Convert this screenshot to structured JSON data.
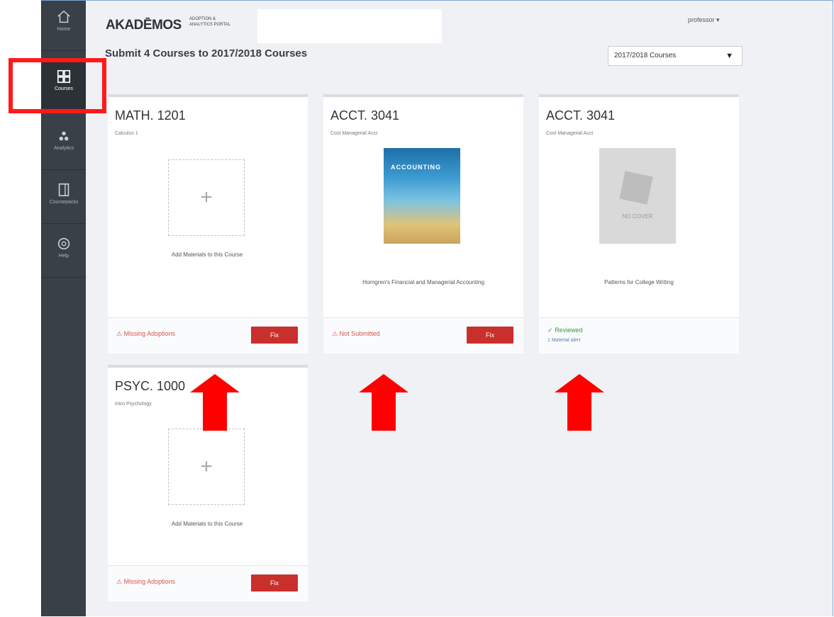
{
  "sidebar": {
    "items": [
      {
        "label": "Home",
        "icon": "home-icon"
      },
      {
        "label": "Courses",
        "icon": "courses-grid-icon",
        "active": true
      },
      {
        "label": "Analytics",
        "icon": "analytics-icon"
      },
      {
        "label": "Coursepacks",
        "icon": "coursepack-icon"
      },
      {
        "label": "Help",
        "icon": "help-icon"
      }
    ]
  },
  "header": {
    "brand": "AKADĒMOS",
    "brand_sub": "ADOPTION & ANALYTICS PORTAL",
    "user_menu": "professor ▾",
    "page_title": "Submit 4 Courses to 2017/2018 Courses",
    "term_select": "2017/2018 Courses"
  },
  "cards": [
    {
      "code": "MATH. 1201",
      "name": "Calculus 1",
      "add_text": "Add Materials to this Course",
      "status": "Missing Adoptions",
      "action": "Fix"
    },
    {
      "code": "ACCT. 3041",
      "name": "Cost Managerial Acct",
      "book_title": "Horngren's Financial and Managerial Accounting",
      "cover_text": "ACCOUNTING",
      "status": "Not Submitted",
      "action": "Fix"
    },
    {
      "code": "ACCT. 3041",
      "name": "Cost Managerial Acct",
      "book_title": "Patterns for College Writing",
      "cover_text": "NO COVER",
      "status": "Reviewed",
      "status_link": "1 Material alert"
    },
    {
      "code": "PSYC. 1000",
      "name": "Intro Psychology",
      "add_text": "Add Materials to this Course",
      "status": "Missing Adoptions",
      "action": "Fix"
    }
  ],
  "colors": {
    "sidebar": "#3a4048",
    "warning": "#d9534f",
    "fix_button": "#c9302c",
    "ok": "#3c9a3c",
    "annotation": "#ff0000"
  }
}
